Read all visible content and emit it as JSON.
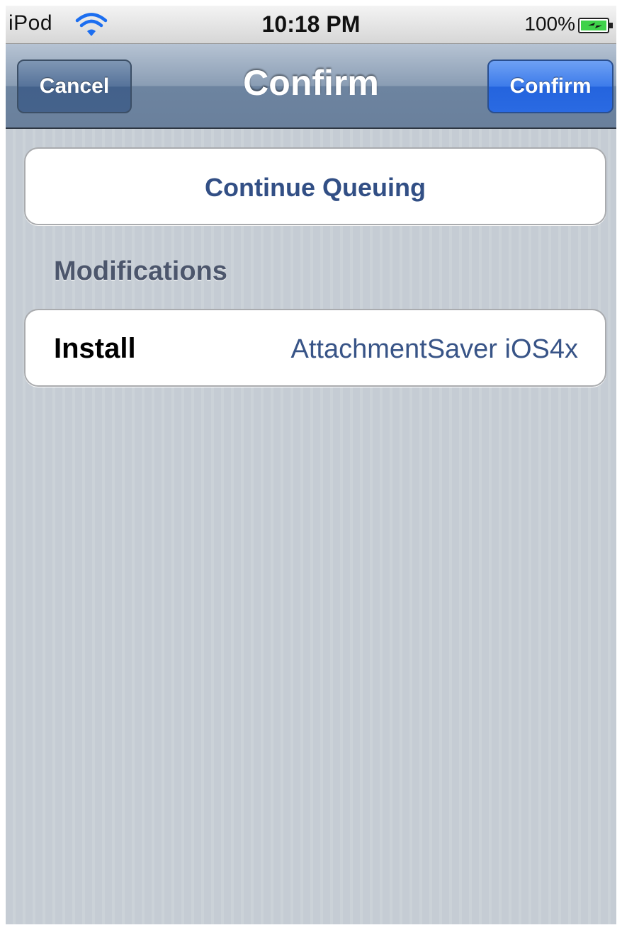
{
  "status_bar": {
    "carrier": "iPod",
    "wifi_icon": "wifi-icon",
    "time": "10:18 PM",
    "battery_percent": "100%",
    "battery_icon": "battery-charging-icon"
  },
  "nav_bar": {
    "title": "Confirm",
    "left_button": "Cancel",
    "right_button": "Confirm"
  },
  "actions": {
    "continue_queuing": "Continue Queuing"
  },
  "modifications": {
    "header": "Modifications",
    "rows": [
      {
        "label": "Install",
        "value": "AttachmentSaver iOS4x"
      }
    ]
  },
  "colors": {
    "nav_bar": "#6d84a0",
    "confirm_button": "#2a6ae2",
    "table_background": "#c5ccd4",
    "link_text": "#324f85"
  }
}
